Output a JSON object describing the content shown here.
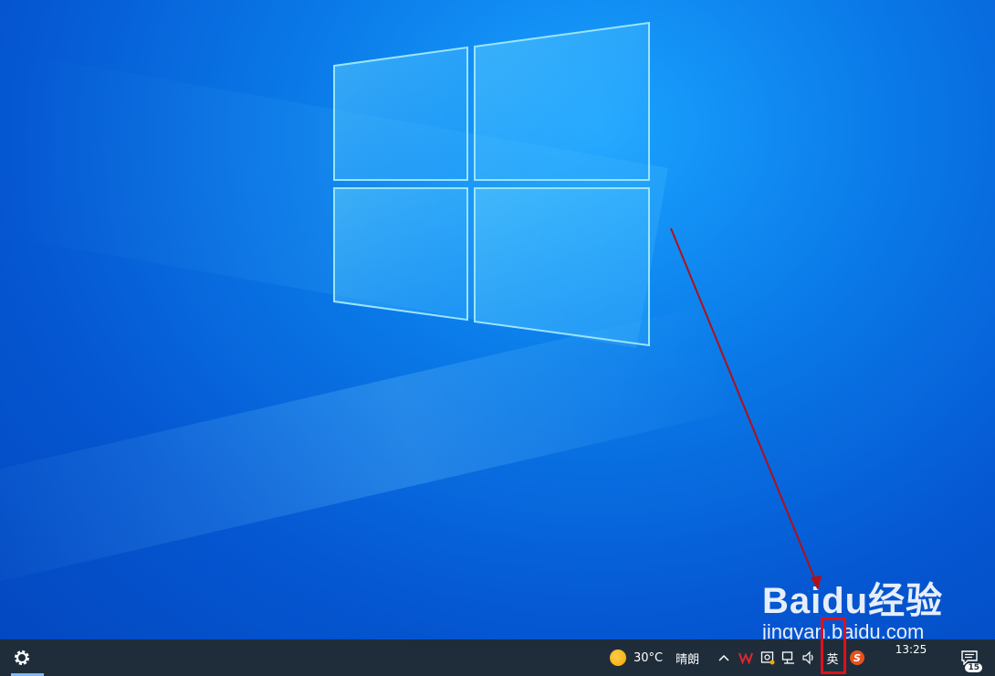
{
  "watermark": {
    "brand": "Baidu经验",
    "url": "jingyan.baidu.com"
  },
  "taskbar": {
    "weather": {
      "temperature": "30°C",
      "condition": "晴朗",
      "icon": "sun-icon"
    },
    "tray": {
      "chevron": "^",
      "input_language": "英",
      "sogou_label": "S"
    },
    "clock": {
      "time": "13:25"
    },
    "notifications": {
      "count": "15"
    },
    "icons": [
      "settings-icon",
      "chevron-up-icon",
      "wps-icon",
      "security-icon",
      "network-icon",
      "volume-icon",
      "sogou-icon",
      "notification-icon"
    ]
  },
  "annotation": {
    "highlight_color": "#e0101a"
  },
  "colors": {
    "taskbar": "#1f2d3a",
    "desktop": "#0a7ae8"
  }
}
